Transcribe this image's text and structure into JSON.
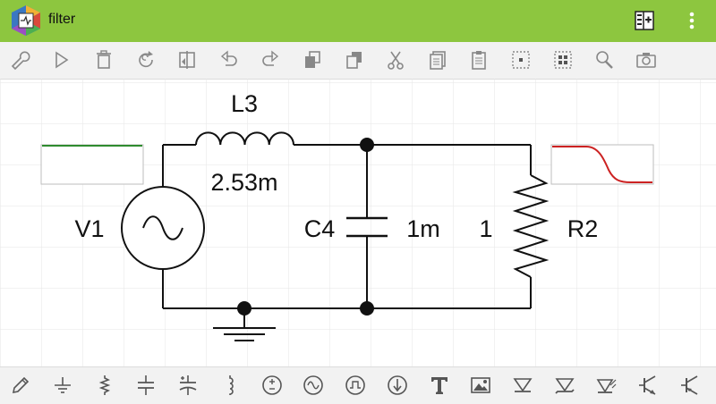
{
  "app": {
    "title": "filter"
  },
  "header": {
    "logo_icon": "circuit-app-logo",
    "actions": [
      {
        "name": "layout-toggle",
        "icon": "layout-icon"
      },
      {
        "name": "overflow-menu",
        "icon": "more-vert-icon"
      }
    ]
  },
  "toolbar_top": [
    "wrench-icon",
    "play-icon",
    "trash-icon",
    "redo-circle-icon",
    "flip-icon",
    "undo-icon",
    "redo-icon",
    "copy-stack-icon",
    "paste-stack-icon",
    "cut-icon",
    "duplicate-icon",
    "clipboard-icon",
    "select-dot-icon",
    "select-grid-icon",
    "zoom-icon",
    "camera-icon"
  ],
  "toolbar_bottom": [
    "pencil-icon",
    "ground-icon",
    "resistor-icon",
    "capacitor-icon",
    "polarized-capacitor-icon",
    "inductor-icon",
    "dc-source-icon",
    "ac-source-icon",
    "square-wave-source-icon",
    "current-source-icon",
    "text-icon",
    "image-icon",
    "diode-icon",
    "zener-diode-icon",
    "led-icon",
    "npn-transistor-icon",
    "pnp-transistor-icon"
  ],
  "circuit": {
    "components": {
      "L3": {
        "label": "L3",
        "value": "2.53m"
      },
      "C4": {
        "label": "C4",
        "value": "1m"
      },
      "R2": {
        "label": "R2",
        "value": "1"
      },
      "V1": {
        "label": "V1"
      }
    }
  },
  "colors": {
    "header": "#8dc63f",
    "toolbar": "#f2f2f2",
    "grid": "#e6e6e6",
    "wire": "#111111",
    "scope_input": "#2e8b2e",
    "scope_output": "#cc2222"
  }
}
